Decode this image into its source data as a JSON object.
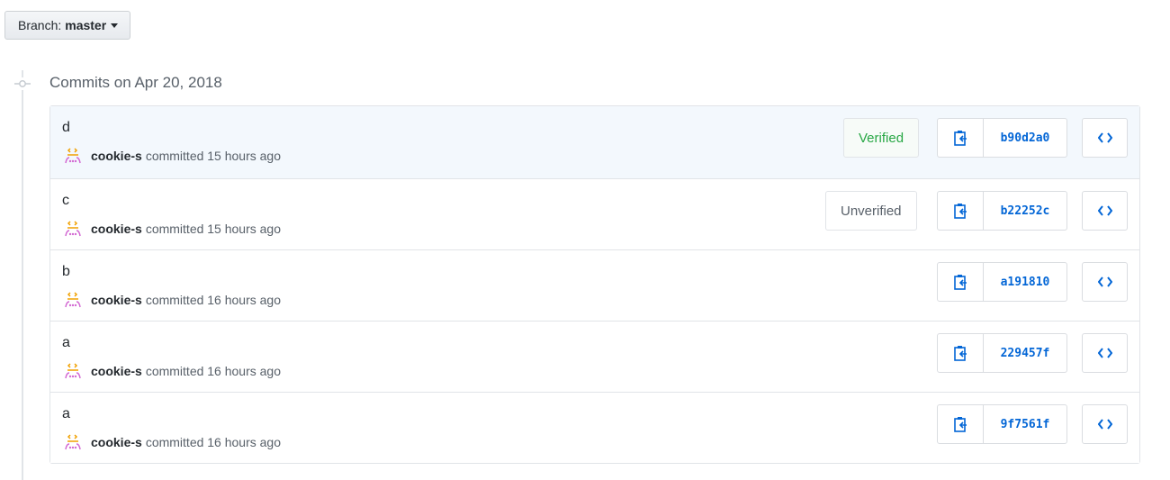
{
  "branch": {
    "prefix": "Branch:",
    "name": "master"
  },
  "group": {
    "title": "Commits on Apr 20, 2018"
  },
  "commits": [
    {
      "message": "d",
      "author": "cookie-s",
      "action": "committed 15 hours ago",
      "signature": "Verified",
      "sha": "b90d2a0"
    },
    {
      "message": "c",
      "author": "cookie-s",
      "action": "committed 15 hours ago",
      "signature": "Unverified",
      "sha": "b22252c"
    },
    {
      "message": "b",
      "author": "cookie-s",
      "action": "committed 16 hours ago",
      "signature": "",
      "sha": "a191810"
    },
    {
      "message": "a",
      "author": "cookie-s",
      "action": "committed 16 hours ago",
      "signature": "",
      "sha": "229457f"
    },
    {
      "message": "a",
      "author": "cookie-s",
      "action": "committed 16 hours ago",
      "signature": "",
      "sha": "9f7561f"
    }
  ],
  "icons": {
    "timeline": "git-commit-icon",
    "copy": "clipboard-icon",
    "browse": "code-icon",
    "avatar": "avatar-icon",
    "caret": "caret-down-icon"
  },
  "colors": {
    "link": "#0366d6",
    "verified": "#28a745",
    "highlight_row": "#f3f8fd"
  }
}
